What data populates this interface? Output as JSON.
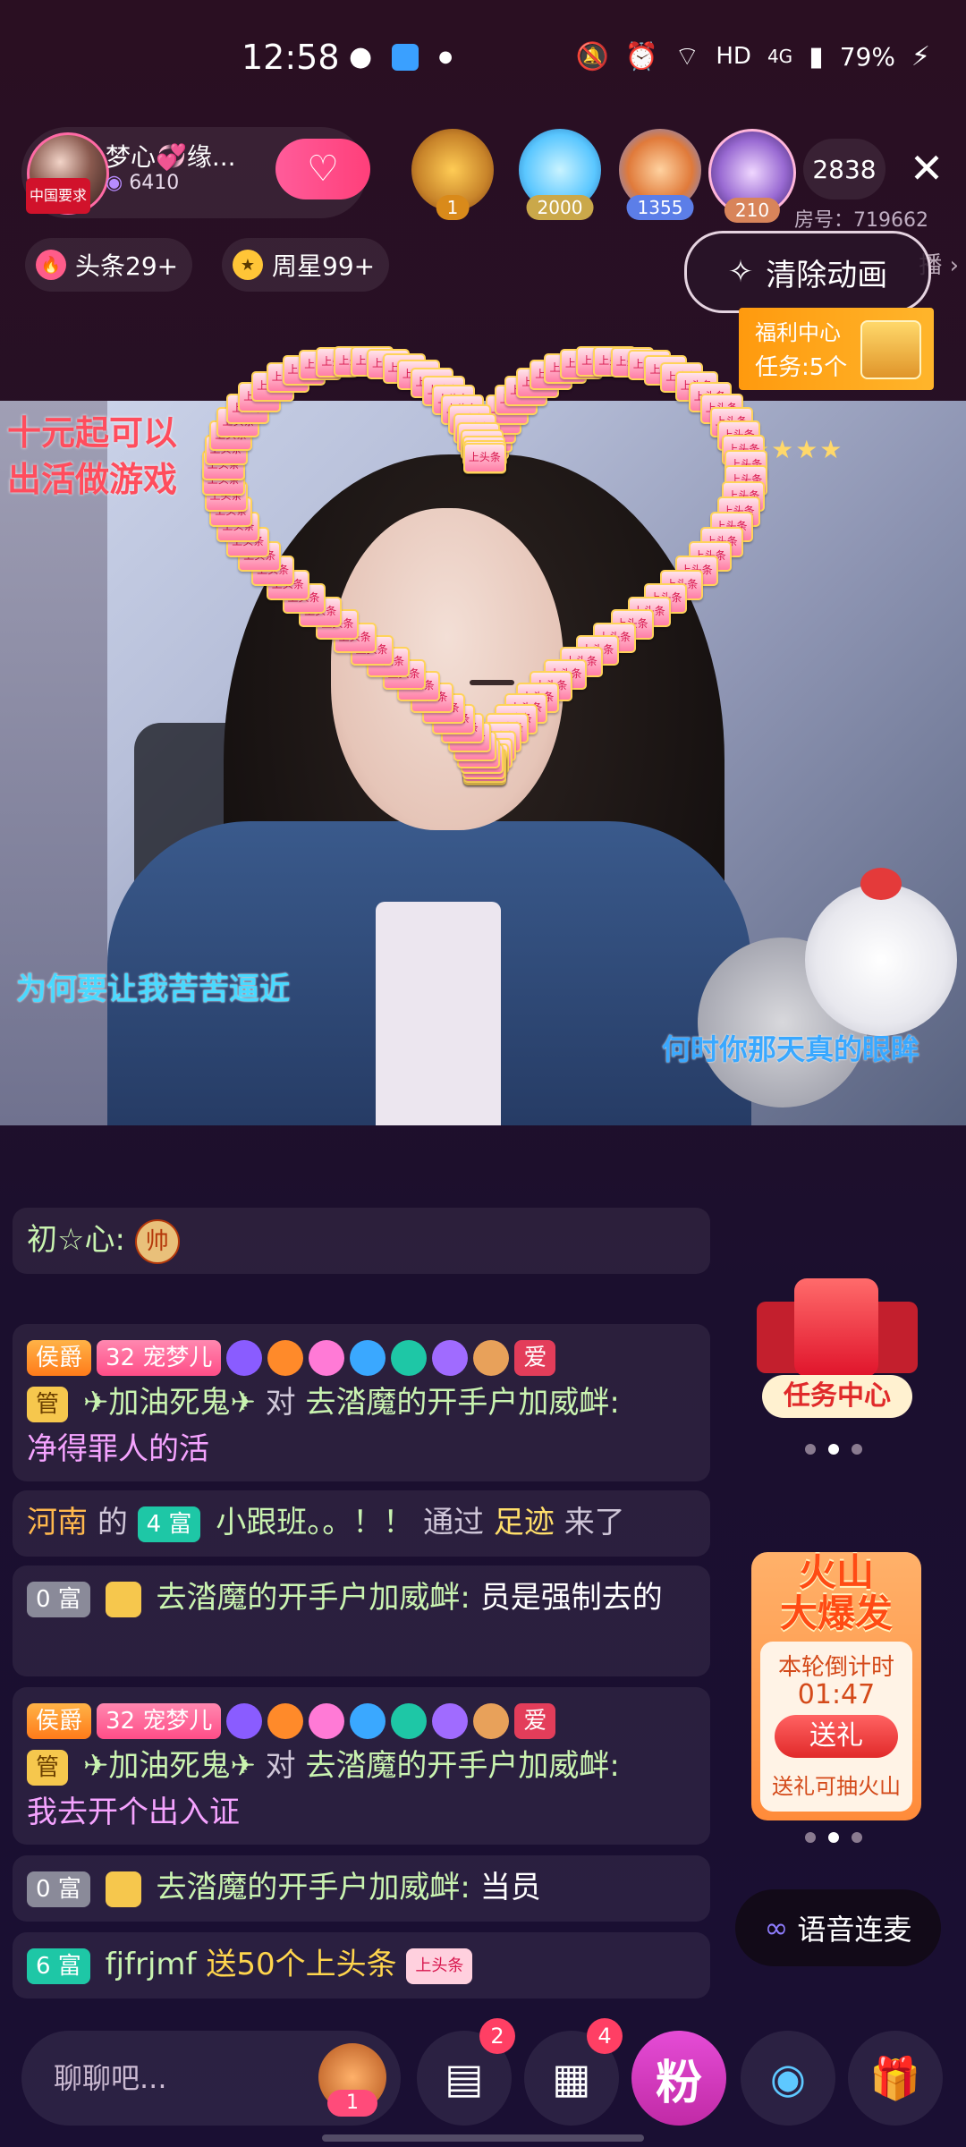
{
  "status_bar": {
    "time": "12:58",
    "network": "HD",
    "signal": "4G",
    "battery": "79%"
  },
  "host": {
    "name": "梦心💞缘...",
    "fans": "6410",
    "avatar_tag": "中国要求"
  },
  "viewers": [
    {
      "badge": "1"
    },
    {
      "badge": "2000"
    },
    {
      "badge": "1355"
    },
    {
      "badge": "210"
    }
  ],
  "viewer_count": "2838",
  "room_no": "房号：719662",
  "pills": {
    "headline": "头条29+",
    "weekstar": "周星99+"
  },
  "clear_animation": "清除动画",
  "live_label": "播",
  "welfare": {
    "title": "福利中心",
    "tasks": "任务:5个"
  },
  "video_overlays": {
    "promo_line1": "十元起可以",
    "promo_line2": "出活做游戏",
    "lyric_left": "为何要让我苦苦逼近",
    "lyric_right": "何时你那天真的眼眸"
  },
  "heart_card_label": "上头条",
  "chat": {
    "m1": {
      "user": "初☆心:",
      "badge": "帅"
    },
    "m2": {
      "tag1": "侯爵",
      "tag2": "32 宠梦儿",
      "tag3": "管",
      "tag4": "爱",
      "user": "✈加油死鬼✈",
      "connector": "对",
      "target": "去涾魔的开手户加威衅:",
      "text": "净得罪人的活"
    },
    "m3": {
      "place": "河南",
      "of": "的",
      "rich": "4 富",
      "user": "小跟班。。！！",
      "via": "通过",
      "method": "足迹",
      "came": "来了"
    },
    "m4": {
      "rich": "0 富",
      "user": "去涾魔的开手户加威衅:",
      "text": "员是强制去的"
    },
    "m5": {
      "tag1": "侯爵",
      "tag2": "32 宠梦儿",
      "tag3": "管",
      "tag4": "爱",
      "user": "✈加油死鬼✈",
      "connector": "对",
      "target": "去涾魔的开手户加威衅:",
      "text": "我去开个出入证"
    },
    "m6": {
      "rich": "0 富",
      "user": "去涾魔的开手户加威衅:",
      "text": "当员"
    },
    "m7": {
      "rich": "6 富",
      "user": "fjfrjmf",
      "text": "送50个上头条",
      "gift_label": "上头条"
    }
  },
  "task_center": "任务中心",
  "volcano": {
    "title_line1": "火山",
    "title_line2": "大爆发",
    "countdown_label": "本轮倒计时",
    "countdown": "01:47",
    "button": "送礼",
    "hint": "送礼可抽火山"
  },
  "voice_link": "语音连麦",
  "bottom_bar": {
    "chat_placeholder": "聊聊吧...",
    "avatar_badge": "1",
    "msg_badge": "2",
    "apps_badge": "4",
    "fans_label": "粉"
  }
}
